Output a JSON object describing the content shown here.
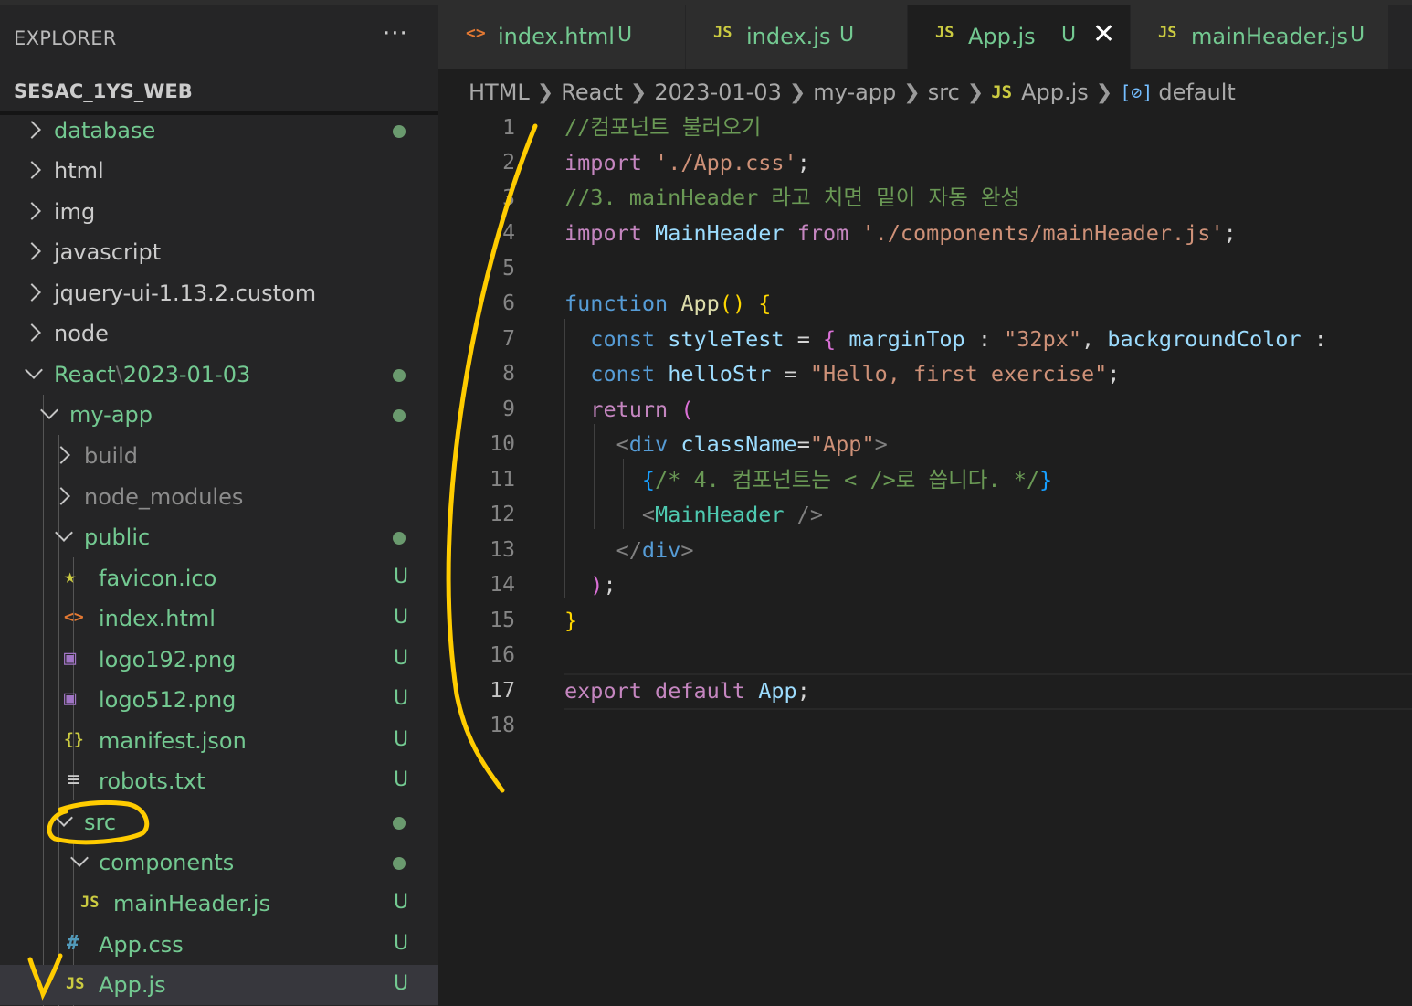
{
  "sidebar": {
    "title": "EXPLORER",
    "more": "···",
    "workspace": "SESAC_1YS_WEB",
    "tree": [
      {
        "label": "database"
      },
      {
        "label": "html"
      },
      {
        "label": "img"
      },
      {
        "label": "javascript"
      },
      {
        "label": "jquery-ui-1.13.2.custom"
      },
      {
        "label": "node"
      },
      {
        "label_a": "React",
        "sep": "\\",
        "label_b": "2023-01-03"
      },
      {
        "label": "my-app"
      },
      {
        "label": "build"
      },
      {
        "label": "node_modules"
      },
      {
        "label": "public"
      },
      {
        "label": "favicon.ico",
        "badge": "U",
        "icon": "★"
      },
      {
        "label": "index.html",
        "badge": "U",
        "icon": "<>"
      },
      {
        "label": "logo192.png",
        "badge": "U",
        "icon": "▣"
      },
      {
        "label": "logo512.png",
        "badge": "U",
        "icon": "▣"
      },
      {
        "label": "manifest.json",
        "badge": "U",
        "icon": "{}"
      },
      {
        "label": "robots.txt",
        "badge": "U",
        "icon": "≡"
      },
      {
        "label": "src"
      },
      {
        "label": "components"
      },
      {
        "label": "mainHeader.js",
        "badge": "U",
        "icon": "JS"
      },
      {
        "label": "App.css",
        "badge": "U",
        "icon": "#"
      },
      {
        "label": "App.js",
        "badge": "U",
        "icon": "JS"
      }
    ]
  },
  "tabs": [
    {
      "name": "index.html",
      "badge": "U",
      "icon": "<>"
    },
    {
      "name": "index.js",
      "badge": "U",
      "icon": "JS"
    },
    {
      "name": "App.js",
      "badge": "U",
      "icon": "JS",
      "close": "✕"
    },
    {
      "name": "mainHeader.js",
      "badge": "U",
      "icon": "JS"
    }
  ],
  "breadcrumb": [
    "HTML",
    "React",
    "2023-01-03",
    "my-app",
    "src",
    "App.js",
    "default"
  ],
  "breadcrumb_js": "JS",
  "breadcrumb_sym": "[⊘]",
  "line_numbers": [
    "1",
    "2",
    "3",
    "4",
    "5",
    "6",
    "7",
    "8",
    "9",
    "10",
    "11",
    "12",
    "13",
    "14",
    "15",
    "16",
    "17",
    "18"
  ],
  "code": {
    "l1": "//컴포넌트 불러오기",
    "l2_kw": "import",
    "l2_str": "'./App.css'",
    "l2_end": ";",
    "l3": "//3. mainHeader 라고 치면 밑이 자동 완성",
    "l4_kw": "import",
    "l4_id": "MainHeader",
    "l4_from": "from",
    "l4_str": "'./components/mainHeader.js'",
    "l4_end": ";",
    "l6_kw": "function",
    "l6_fn": "App",
    "l6_paren": "()",
    "l6_brace": "{",
    "l7_kw": "const",
    "l7_id": "styleTest",
    "l7_eq": "=",
    "l7_brace": "{",
    "l7_p1": "marginTop",
    "l7_c1": ":",
    "l7_s1": "\"32px\"",
    "l7_comma": ",",
    "l7_p2": "backgroundColor",
    "l7_c2": ":",
    "l8_kw": "const",
    "l8_id": "helloStr",
    "l8_eq": "=",
    "l8_str": "\"Hello, first exercise\"",
    "l8_end": ";",
    "l9_kw": "return",
    "l9_paren": "(",
    "l10_lt": "<",
    "l10_tag": "div",
    "l10_attr": "className",
    "l10_eq": "=",
    "l10_val": "\"App\"",
    "l10_gt": ">",
    "l11_open": "{",
    "l11_comment": "/* 4. 컴포넌트는 < />로 씁니다. */",
    "l11_close": "}",
    "l12_lt": "<",
    "l12_tag": "MainHeader",
    "l12_gt": " />",
    "l13_lt": "</",
    "l13_tag": "div",
    "l13_gt": ">",
    "l14_paren": ")",
    "l14_end": ";",
    "l15_brace": "}",
    "l17_kw1": "export",
    "l17_kw2": "default",
    "l17_id": "App",
    "l17_end": ";"
  },
  "colors": {
    "accent_annotation": "#ffcc00",
    "git_untracked": "#73c991"
  }
}
